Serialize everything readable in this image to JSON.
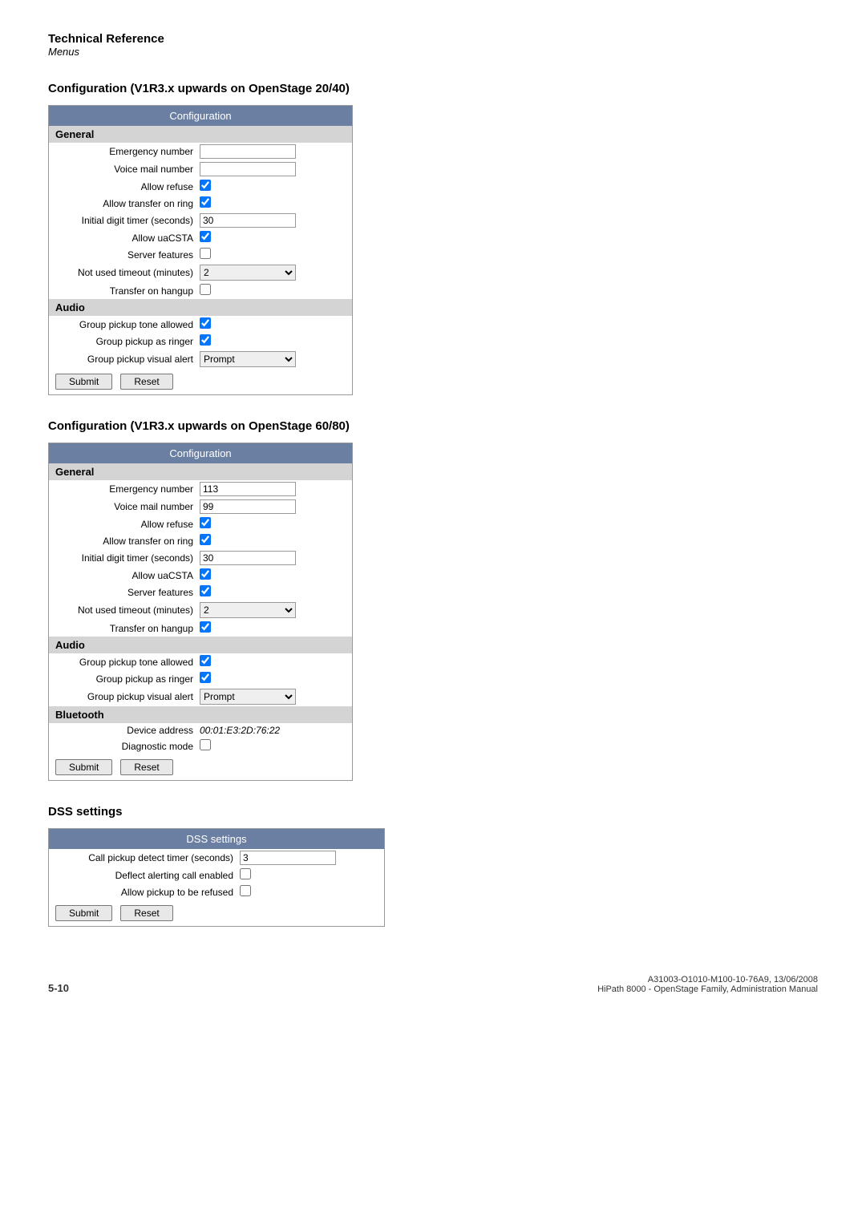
{
  "header": {
    "title": "Technical Reference",
    "subtitle": "Menus"
  },
  "section1": {
    "heading": "Configuration (V1R3.x upwards on OpenStage 20/40)",
    "panel_title": "Configuration",
    "general_label": "General",
    "audio_label": "Audio",
    "rows_general": [
      {
        "label": "Emergency number",
        "type": "text",
        "value": ""
      },
      {
        "label": "Voice mail number",
        "type": "text",
        "value": ""
      },
      {
        "label": "Allow refuse",
        "type": "checkbox",
        "checked": true
      },
      {
        "label": "Allow transfer on ring",
        "type": "checkbox",
        "checked": true
      },
      {
        "label": "Initial digit timer (seconds)",
        "type": "text",
        "value": "30"
      },
      {
        "label": "Allow uaCSTA",
        "type": "checkbox",
        "checked": true
      },
      {
        "label": "Server features",
        "type": "checkbox",
        "checked": false
      },
      {
        "label": "Not used timeout (minutes)",
        "type": "select",
        "value": "2"
      },
      {
        "label": "Transfer on hangup",
        "type": "checkbox",
        "checked": false
      }
    ],
    "rows_audio": [
      {
        "label": "Group pickup tone allowed",
        "type": "checkbox",
        "checked": true
      },
      {
        "label": "Group pickup as ringer",
        "type": "checkbox",
        "checked": true
      },
      {
        "label": "Group pickup visual alert",
        "type": "select",
        "value": "Prompt"
      }
    ],
    "submit_label": "Submit",
    "reset_label": "Reset"
  },
  "section2": {
    "heading": "Configuration (V1R3.x upwards on OpenStage 60/80)",
    "panel_title": "Configuration",
    "general_label": "General",
    "audio_label": "Audio",
    "bluetooth_label": "Bluetooth",
    "rows_general": [
      {
        "label": "Emergency number",
        "type": "text",
        "value": "113"
      },
      {
        "label": "Voice mail number",
        "type": "text",
        "value": "99"
      },
      {
        "label": "Allow refuse",
        "type": "checkbox",
        "checked": true
      },
      {
        "label": "Allow transfer on ring",
        "type": "checkbox",
        "checked": true
      },
      {
        "label": "Initial digit timer (seconds)",
        "type": "text",
        "value": "30"
      },
      {
        "label": "Allow uaCSTA",
        "type": "checkbox",
        "checked": true
      },
      {
        "label": "Server features",
        "type": "checkbox",
        "checked": true
      },
      {
        "label": "Not used timeout (minutes)",
        "type": "select",
        "value": "2"
      },
      {
        "label": "Transfer on hangup",
        "type": "checkbox",
        "checked": true
      }
    ],
    "rows_audio": [
      {
        "label": "Group pickup tone allowed",
        "type": "checkbox",
        "checked": true
      },
      {
        "label": "Group pickup as ringer",
        "type": "checkbox",
        "checked": true
      },
      {
        "label": "Group pickup visual alert",
        "type": "select",
        "value": "Prompt"
      }
    ],
    "rows_bluetooth": [
      {
        "label": "Device address",
        "type": "italic_text",
        "value": "00:01:E3:2D:76:22"
      },
      {
        "label": "Diagnostic mode",
        "type": "checkbox",
        "checked": false
      }
    ],
    "submit_label": "Submit",
    "reset_label": "Reset"
  },
  "section3": {
    "heading": "DSS settings",
    "panel_title": "DSS settings",
    "rows": [
      {
        "label": "Call pickup detect timer (seconds)",
        "type": "text",
        "value": "3"
      },
      {
        "label": "Deflect alerting call enabled",
        "type": "checkbox",
        "checked": false
      },
      {
        "label": "Allow pickup to be refused",
        "type": "checkbox",
        "checked": false
      }
    ],
    "submit_label": "Submit",
    "reset_label": "Reset"
  },
  "footer": {
    "page_number": "5-10",
    "document_ref": "A31003-O1010-M100-10-76A9, 13/06/2008",
    "document_title": "HiPath 8000 - OpenStage Family, Administration Manual"
  }
}
